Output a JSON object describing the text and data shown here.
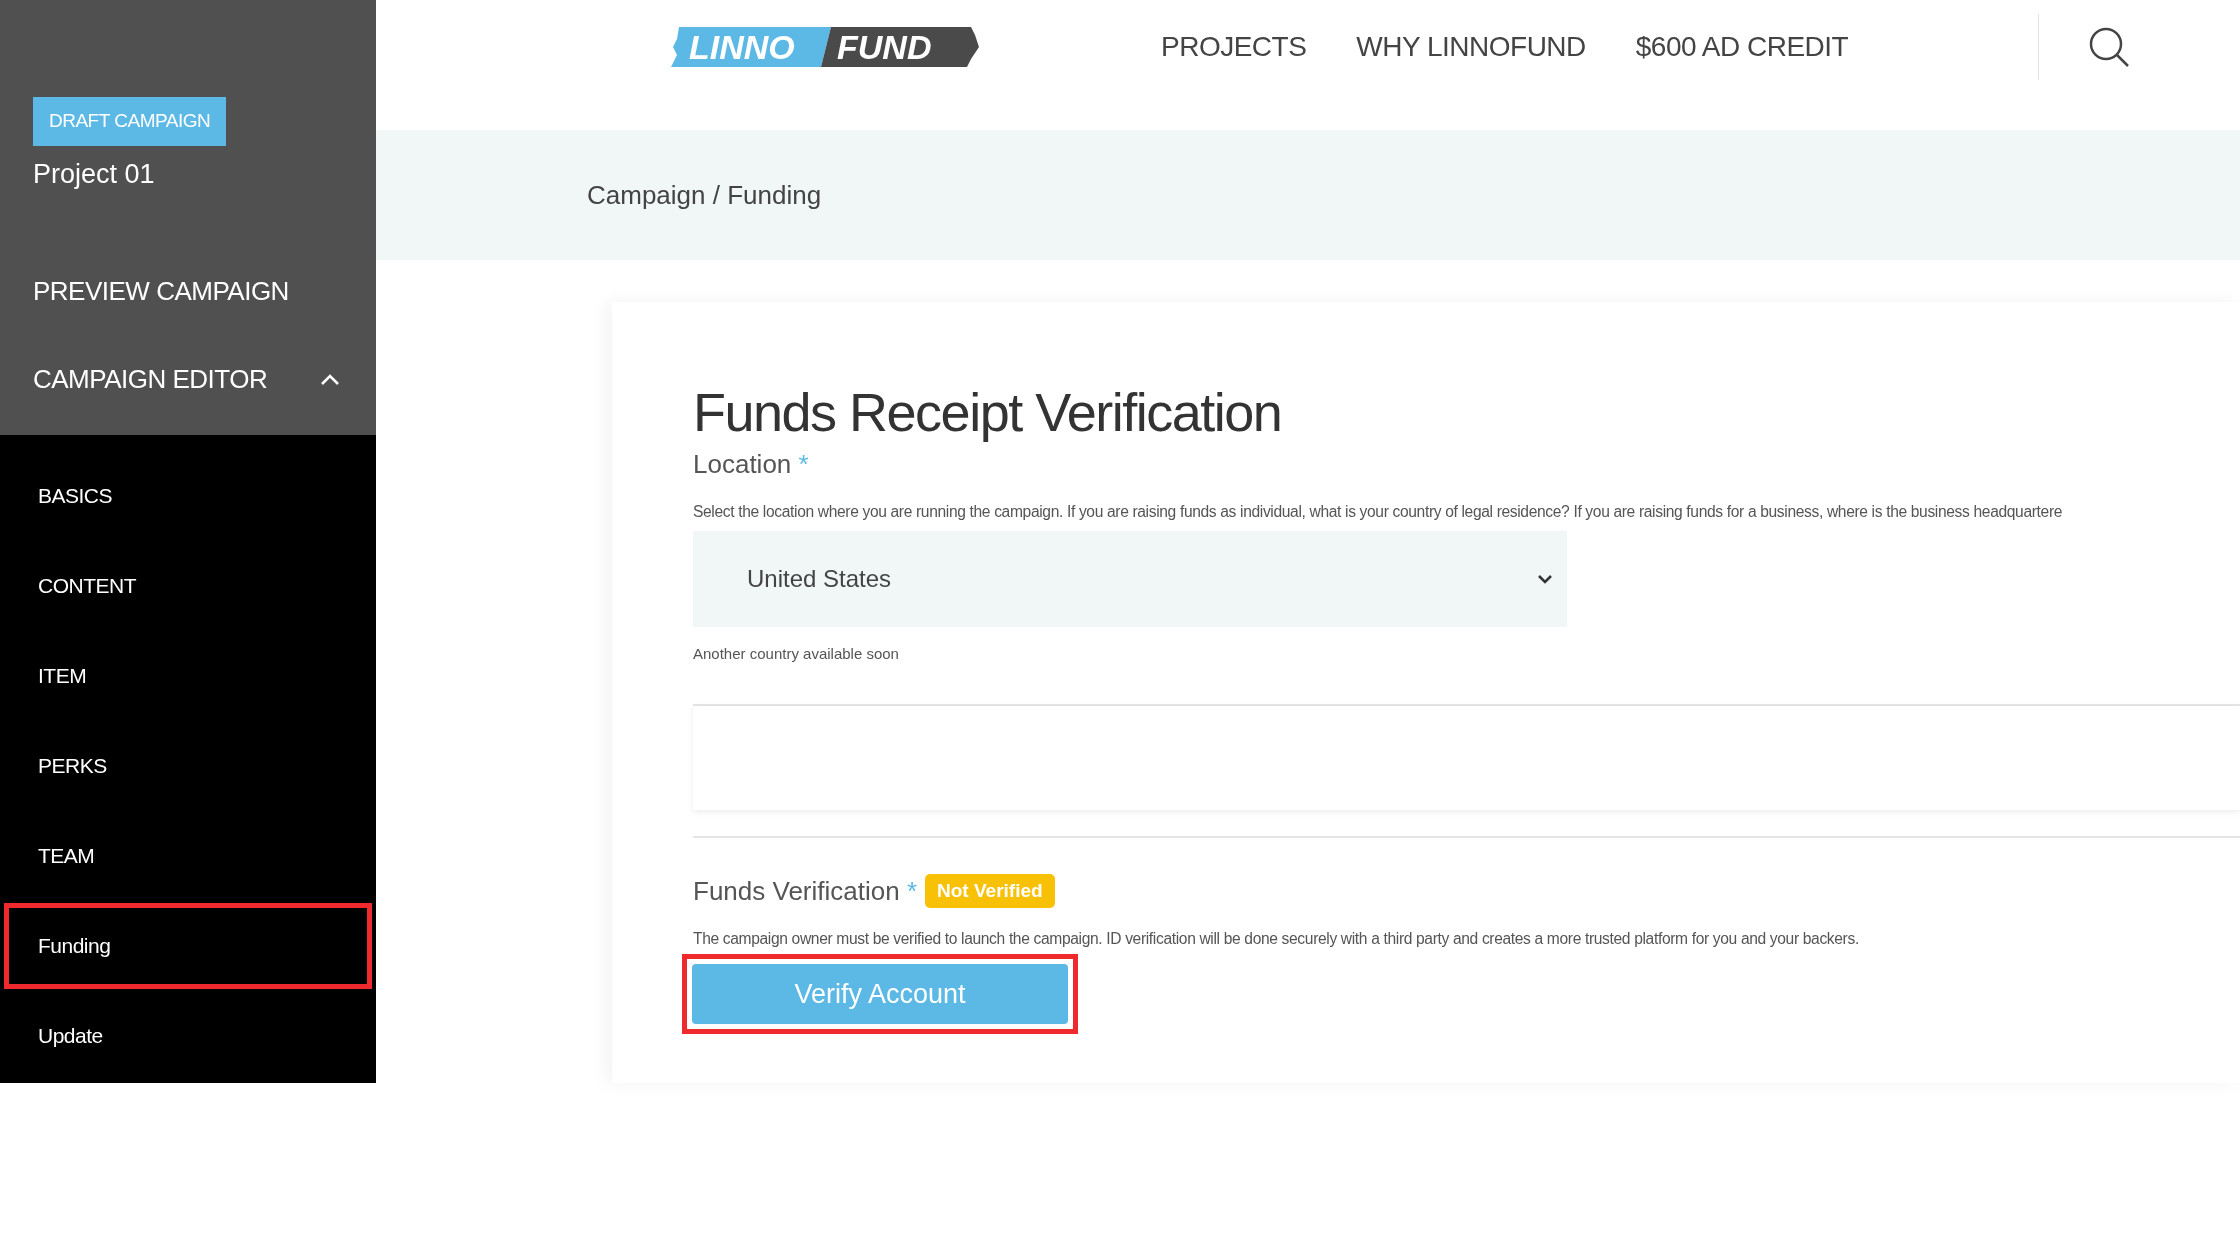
{
  "header": {
    "logo": {
      "left": "LINNO",
      "right": "FUND"
    },
    "nav": [
      "PROJECTS",
      "WHY LINNOFUND",
      "$600 AD CREDIT"
    ]
  },
  "sidebar": {
    "badge": "DRAFT CAMPAIGN",
    "project": "Project 01",
    "preview": "PREVIEW CAMPAIGN",
    "editor": {
      "label": "CAMPAIGN EDITOR",
      "expanded": true
    },
    "items": [
      {
        "label": "BASICS",
        "highlighted": false
      },
      {
        "label": "CONTENT",
        "highlighted": false
      },
      {
        "label": "ITEM",
        "highlighted": false
      },
      {
        "label": "PERKS",
        "highlighted": false
      },
      {
        "label": "TEAM",
        "highlighted": false
      },
      {
        "label": "Funding",
        "highlighted": true
      },
      {
        "label": "Update",
        "highlighted": false
      }
    ]
  },
  "breadcrumb": "Campaign / Funding",
  "form": {
    "title": "Funds Receipt Verification",
    "location": {
      "label": "Location",
      "required_mark": "*",
      "help": "Select the location where you are running the campaign. If you are raising funds as individual, what is your country of legal residence? If you are raising funds for a business, where is the business headquartere",
      "value": "United States",
      "note": "Another country available soon"
    },
    "verification": {
      "label": "Funds Verification",
      "required_mark": "*",
      "status": "Not Verified",
      "help": "The campaign owner must be verified to launch the campaign. ID verification will be done securely with a third party and creates a more trusted platform for you and your backers.",
      "button": {
        "label": "Verify Account",
        "highlighted": true
      }
    }
  }
}
